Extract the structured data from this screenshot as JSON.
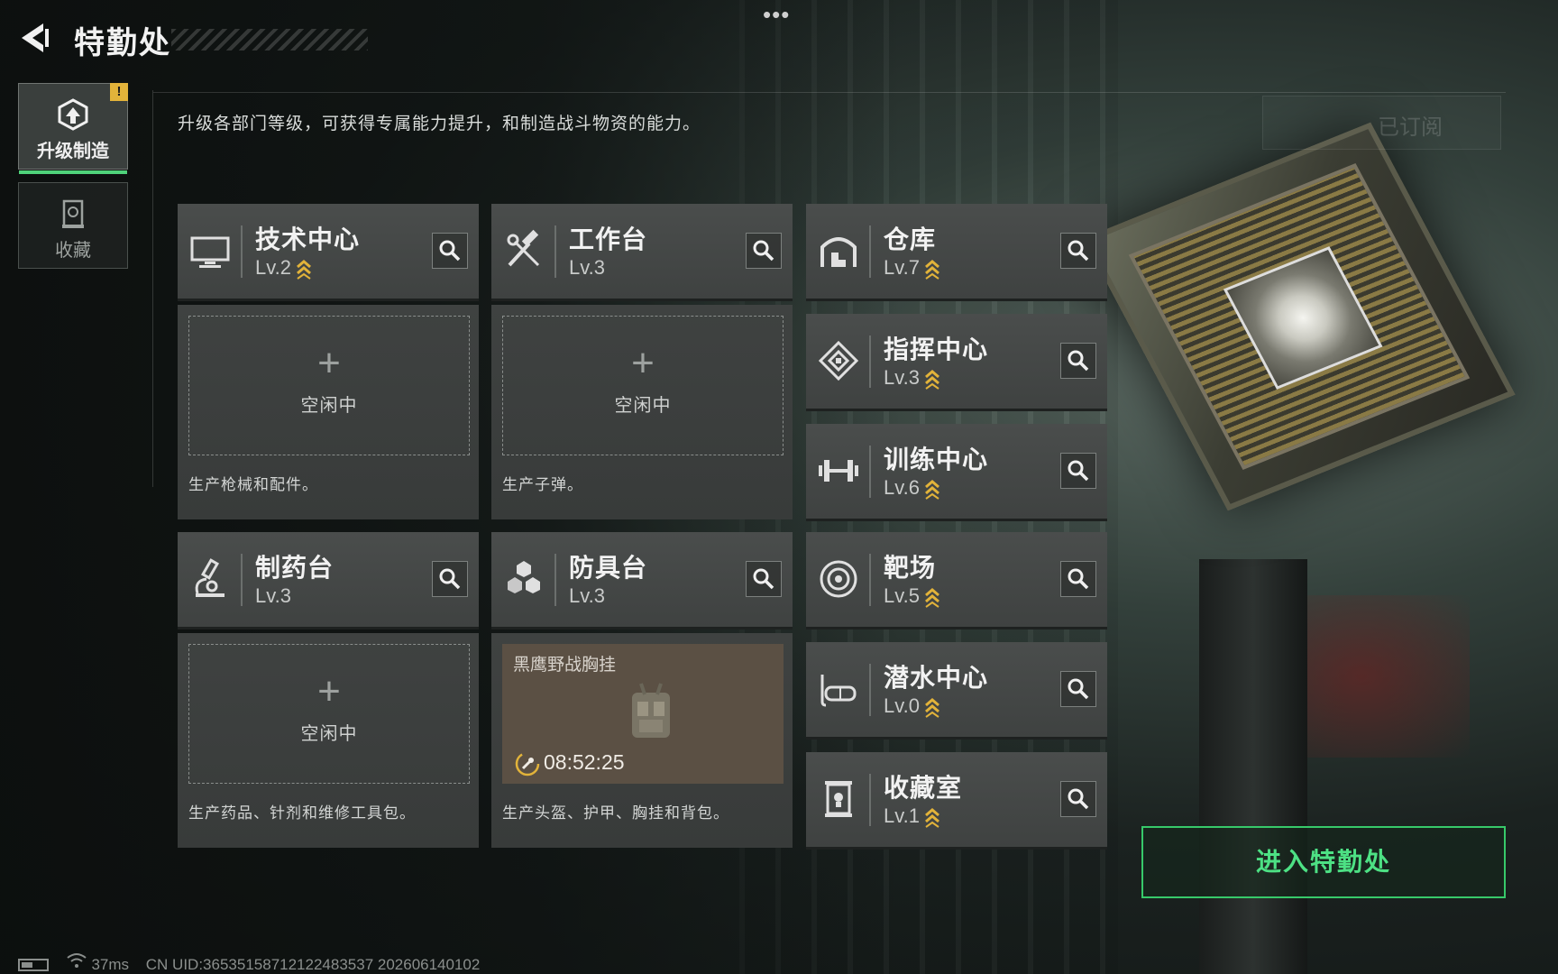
{
  "header": {
    "title": "特勤处"
  },
  "side_tabs": [
    {
      "label": "升级制造",
      "active": true,
      "alert": "!"
    },
    {
      "label": "收藏",
      "active": false
    }
  ],
  "description": "升级各部门等级，可获得专属能力提升，和制造战斗物资的能力。",
  "subscribed_label": "已订阅",
  "departments": [
    {
      "name": "技术中心",
      "level": "Lv.2",
      "upgradable": true,
      "icon": "monitor-icon"
    },
    {
      "name": "工作台",
      "level": "Lv.3",
      "upgradable": false,
      "icon": "hammer-wrench-icon"
    },
    {
      "name": "制药台",
      "level": "Lv.3",
      "upgradable": false,
      "icon": "microscope-icon"
    },
    {
      "name": "防具台",
      "level": "Lv.3",
      "upgradable": false,
      "icon": "blocks-icon"
    },
    {
      "name": "仓库",
      "level": "Lv.7",
      "upgradable": true,
      "icon": "warehouse-icon"
    },
    {
      "name": "指挥中心",
      "level": "Lv.3",
      "upgradable": true,
      "icon": "diamond-target-icon"
    },
    {
      "name": "训练中心",
      "level": "Lv.6",
      "upgradable": true,
      "icon": "dumbbell-icon"
    },
    {
      "name": "靶场",
      "level": "Lv.5",
      "upgradable": true,
      "icon": "target-icon"
    },
    {
      "name": "潜水中心",
      "level": "Lv.0",
      "upgradable": true,
      "icon": "diving-mask-icon"
    },
    {
      "name": "收藏室",
      "level": "Lv.1",
      "upgradable": true,
      "icon": "display-case-icon"
    }
  ],
  "production": {
    "tech_center": {
      "status": "空闲中",
      "desc": "生产枪械和配件。"
    },
    "workbench": {
      "status": "空闲中",
      "desc": "生产子弹。"
    },
    "pharmacy": {
      "status": "空闲中",
      "desc": "生产药品、针剂和维修工具包。"
    },
    "armor_bench": {
      "item_name": "黑鹰野战胸挂",
      "timer": "08:52:25",
      "desc": "生产头盔、护甲、胸挂和背包。"
    }
  },
  "enter_button": "进入特勤处",
  "footer": {
    "ping": "37ms",
    "uid": "CN UID:3653515871212248353​7 202606140102"
  },
  "colors": {
    "accent_green": "#4de184",
    "upgrade_gold": "#e2b33a",
    "alert_yellow": "#e2b33a"
  }
}
